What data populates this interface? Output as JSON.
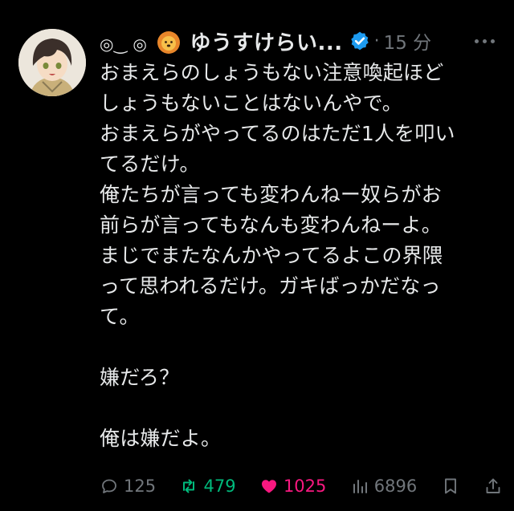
{
  "tweet": {
    "author_prefix": "◎‿ ◎",
    "author_name": "ゆうすけらい...",
    "separator": "·",
    "time": "15 分",
    "body": "おまえらのしょうもない注意喚起ほど\nしょうもないことはないんやで。\nおまえらがやってるのはただ1人を叩い\nてるだけ。\n俺たちが言っても変わんねー奴らがお\n前らが言ってもなんも変わんねーよ。\nまじでまたなんかやってるよこの界隈\nって思われるだけ。ガキばっかだなっ\nて。\n\n嫌だろ？\n\n俺は嫌だよ。"
  },
  "actions": {
    "replies": "125",
    "retweets": "479",
    "likes": "1025",
    "views": "6896"
  },
  "icons": {
    "avatar": "anime-character-avatar",
    "lion": "lion-emoji",
    "verified": "verified-badge-icon",
    "more": "more-dots-icon",
    "reply": "reply-icon",
    "retweet": "retweet-icon",
    "like": "heart-icon",
    "views": "views-chart-icon",
    "bookmark": "bookmark-icon",
    "share": "share-icon"
  },
  "colors": {
    "background": "#000000",
    "text": "#e7e9ea",
    "muted": "#71767b",
    "verified": "#1d9bf0",
    "retweet": "#00ba7c",
    "like": "#f91880"
  }
}
